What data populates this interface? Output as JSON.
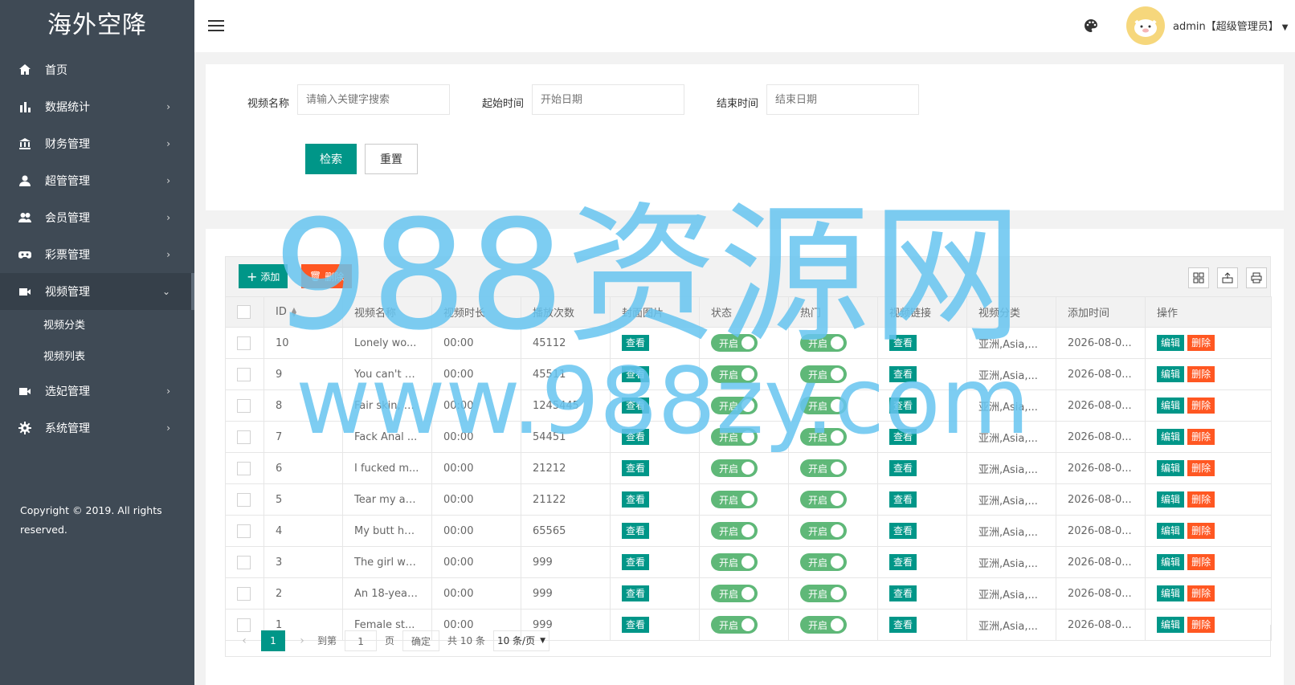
{
  "brand": "海外空降",
  "sidebar": {
    "items": [
      {
        "label": "首页",
        "icon": "home-icon"
      },
      {
        "label": "数据统计",
        "icon": "bar-chart-icon"
      },
      {
        "label": "财务管理",
        "icon": "bank-icon"
      },
      {
        "label": "超管管理",
        "icon": "user-icon"
      },
      {
        "label": "会员管理",
        "icon": "users-icon"
      },
      {
        "label": "彩票管理",
        "icon": "gamepad-icon"
      },
      {
        "label": "视频管理",
        "icon": "video-icon"
      },
      {
        "label": "选妃管理",
        "icon": "video-icon"
      },
      {
        "label": "系统管理",
        "icon": "gear-icon"
      }
    ],
    "sub_items": [
      "视频分类",
      "视频列表"
    ],
    "copyright": "Copyright © 2019. All rights reserved."
  },
  "header": {
    "user": "admin【超级管理员】"
  },
  "search": {
    "name_label": "视频名称",
    "name_placeholder": "请输入关键字搜索",
    "start_label": "起始时间",
    "start_placeholder": "开始日期",
    "end_label": "结束时间",
    "end_placeholder": "结束日期",
    "search_btn": "检索",
    "reset_btn": "重置"
  },
  "toolbar": {
    "add": "添加",
    "delete": "删除"
  },
  "table": {
    "headers": [
      "ID",
      "视频名称",
      "视频时长",
      "播放次数",
      "封面图片",
      "状态",
      "热门",
      "视频链接",
      "视频分类",
      "添加时间",
      "操作"
    ],
    "view_label": "查看",
    "switch_label": "开启",
    "edit_label": "编辑",
    "delete_label": "删除",
    "rows": [
      {
        "id": "10",
        "name": "Lonely wo...",
        "duration": "00:00",
        "plays": "45112",
        "category": "亚洲,Asia,...",
        "time": "2026-08-0..."
      },
      {
        "id": "9",
        "name": "You can't c...",
        "duration": "00:00",
        "plays": "45511",
        "category": "亚洲,Asia,...",
        "time": "2026-08-0..."
      },
      {
        "id": "8",
        "name": "Fair skin, b...",
        "duration": "00:00",
        "plays": "1245445",
        "category": "亚洲,Asia,...",
        "time": "2026-08-0..."
      },
      {
        "id": "7",
        "name": "Fack Anal ...",
        "duration": "00:00",
        "plays": "54451",
        "category": "亚洲,Asia,...",
        "time": "2026-08-0..."
      },
      {
        "id": "6",
        "name": "I fucked m...",
        "duration": "00:00",
        "plays": "21212",
        "category": "亚洲,Asia,...",
        "time": "2026-08-0..."
      },
      {
        "id": "5",
        "name": "Tear my as...",
        "duration": "00:00",
        "plays": "21122",
        "category": "亚洲,Asia,...",
        "time": "2026-08-0..."
      },
      {
        "id": "4",
        "name": "My butt hu...",
        "duration": "00:00",
        "plays": "65565",
        "category": "亚洲,Asia,...",
        "time": "2026-08-0..."
      },
      {
        "id": "3",
        "name": "The girl wa...",
        "duration": "00:00",
        "plays": "999",
        "category": "亚洲,Asia,...",
        "time": "2026-08-0..."
      },
      {
        "id": "2",
        "name": "An 18-year...",
        "duration": "00:00",
        "plays": "999",
        "category": "亚洲,Asia,...",
        "time": "2026-08-0..."
      },
      {
        "id": "1",
        "name": "Female st...",
        "duration": "00:00",
        "plays": "999",
        "category": "亚洲,Asia,...",
        "time": "2026-08-0..."
      }
    ]
  },
  "pager": {
    "current": "1",
    "goto_label": "到第",
    "goto_value": "1",
    "page_label": "页",
    "confirm": "确定",
    "total": "共 10 条",
    "page_size": "10 条/页"
  },
  "watermark": {
    "line1": "988资源网",
    "line2": "www.988zy.com"
  },
  "colors": {
    "sidebar_bg": "#3f4a55",
    "primary": "#009688",
    "danger": "#ff5722",
    "switch_on": "#5fb878",
    "watermark": "#66c4f0"
  }
}
